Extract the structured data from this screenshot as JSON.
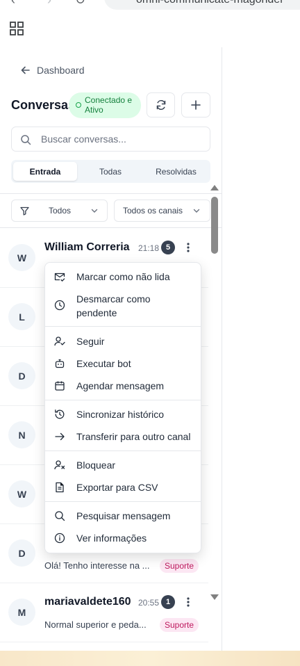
{
  "browser": {
    "url_text": "omni-communicate-magonder"
  },
  "sidebar": {
    "back_label": "Dashboard",
    "title": "Conversas",
    "status_line1": "Conectado e",
    "status_line2": "Ativo",
    "search_placeholder": "Buscar conversas...",
    "tabs": [
      {
        "label": "Entrada",
        "active": true
      },
      {
        "label": "Todas",
        "active": false
      },
      {
        "label": "Resolvidas",
        "active": false
      }
    ],
    "filters": {
      "status_selected": "Todos",
      "channel_selected": "Todos os canais"
    }
  },
  "conversations": [
    {
      "initial": "W",
      "name": "William Correria",
      "time": "21:18",
      "count": "5",
      "preview": "",
      "tag": ""
    },
    {
      "initial": "L",
      "name": "",
      "time": "",
      "count": "",
      "preview": "",
      "tag": ""
    },
    {
      "initial": "D",
      "name": "",
      "time": "",
      "count": "",
      "preview": "",
      "tag": ""
    },
    {
      "initial": "N",
      "name": "",
      "time": "",
      "count": "",
      "preview": "",
      "tag": ""
    },
    {
      "initial": "W",
      "name": "",
      "time": "",
      "count": "",
      "preview": "",
      "tag": ""
    },
    {
      "initial": "D",
      "name": "",
      "time": "",
      "count": "",
      "preview": "Olá! Tenho interesse na ...",
      "tag": "Suporte"
    },
    {
      "initial": "M",
      "name": "mariavaldete160",
      "time": "20:55",
      "count": "1",
      "preview": "Normal superior e peda...",
      "tag": "Suporte"
    }
  ],
  "context_menu": {
    "items": [
      {
        "label": "Marcar como não lida",
        "icon": "mail-check-icon"
      },
      {
        "label": "Desmarcar como",
        "label2": "pendente",
        "icon": "clock-icon"
      },
      {
        "label": "Seguir",
        "icon": "user-check-icon"
      },
      {
        "label": "Executar bot",
        "icon": "bot-icon"
      },
      {
        "label": "Agendar mensagem",
        "icon": "calendar-icon"
      },
      {
        "label": "Sincronizar histórico",
        "icon": "history-icon"
      },
      {
        "label": "Transferir para outro canal",
        "icon": "arrow-right-icon"
      },
      {
        "label": "Bloquear",
        "icon": "user-x-icon"
      },
      {
        "label": "Exportar para CSV",
        "icon": "file-text-icon"
      },
      {
        "label": "Pesquisar mensagem",
        "icon": "search-icon"
      },
      {
        "label": "Ver informações",
        "icon": "info-icon"
      }
    ]
  },
  "colors": {
    "status_bg": "#dcfce7",
    "status_text": "#15803d",
    "tag_bg": "#fce7f3",
    "tag_text": "#be185d",
    "count_bg": "#374151"
  }
}
